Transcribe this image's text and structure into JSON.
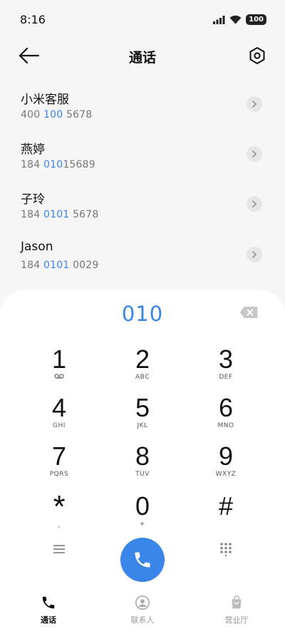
{
  "status": {
    "time": "8:16",
    "battery": "100"
  },
  "header": {
    "title": "通话"
  },
  "contacts": [
    {
      "name": "小米客服",
      "num_pre": "400",
      "num_hl": " 100",
      "num_post": " 5678"
    },
    {
      "name": "燕婷",
      "num_pre": "184 ",
      "num_hl": "010",
      "num_post": "15689"
    },
    {
      "name": "子玲",
      "num_pre": "184 ",
      "num_hl": "0101",
      "num_post": " 5678"
    },
    {
      "name": "Jason",
      "num_pre": "184 ",
      "num_hl": "0101",
      "num_post": " 0029"
    }
  ],
  "dialer": {
    "display": "010",
    "keys": [
      {
        "digit": "1",
        "letters": ""
      },
      {
        "digit": "2",
        "letters": "ABC"
      },
      {
        "digit": "3",
        "letters": "DEF"
      },
      {
        "digit": "4",
        "letters": "GHI"
      },
      {
        "digit": "5",
        "letters": "JKL"
      },
      {
        "digit": "6",
        "letters": "MNO"
      },
      {
        "digit": "7",
        "letters": "PQRS"
      },
      {
        "digit": "8",
        "letters": "TUV"
      },
      {
        "digit": "9",
        "letters": "WXYZ"
      },
      {
        "digit": "*",
        "letters": ","
      },
      {
        "digit": "0",
        "letters": "+"
      },
      {
        "digit": "#",
        "letters": ""
      }
    ]
  },
  "nav": {
    "calls": "通话",
    "contacts": "联系人",
    "hall": "营业厅"
  },
  "colors": {
    "accent": "#3a86e8",
    "background": "#f6f6f6",
    "dialer_bg": "#ffffff"
  }
}
